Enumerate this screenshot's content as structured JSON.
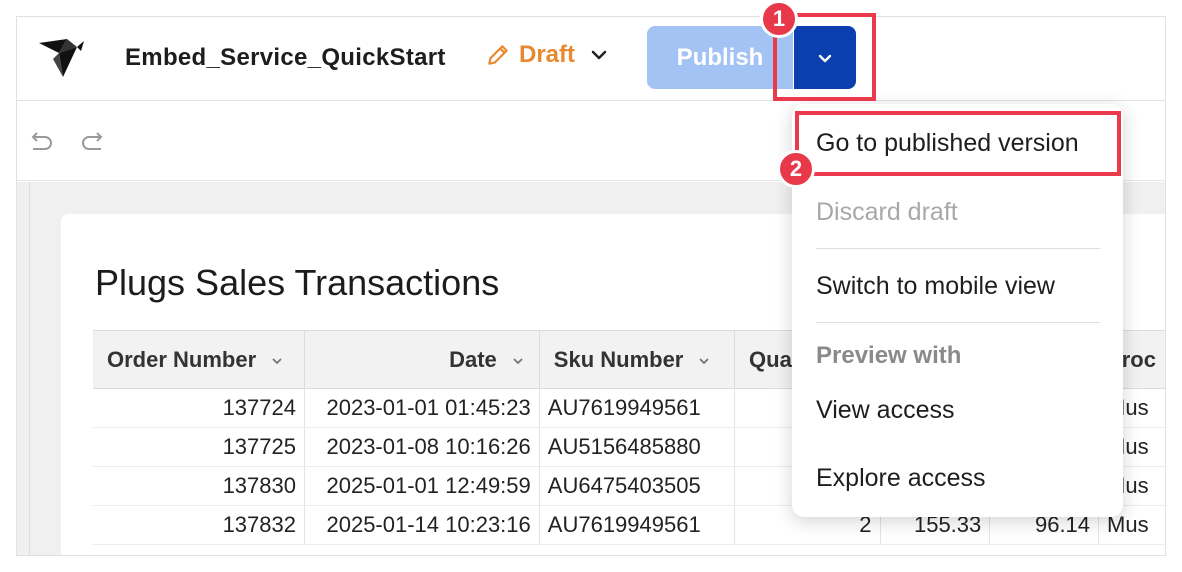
{
  "header": {
    "workbook_title": "Embed_Service_QuickStart",
    "status_label": "Draft",
    "publish_label": "Publish"
  },
  "toolbar": {
    "undo_icon": "undo-icon",
    "redo_icon": "redo-icon"
  },
  "card": {
    "title": "Plugs Sales Transactions"
  },
  "table": {
    "columns": [
      "Order Number",
      "Date",
      "Sku Number",
      "Qua",
      "",
      "",
      "Proc"
    ],
    "rows": [
      [
        "137724",
        "2023-01-01 01:45:23",
        "AU7619949561",
        "",
        "",
        "",
        "Mus"
      ],
      [
        "137725",
        "2023-01-08 10:16:26",
        "AU5156485880",
        "",
        "",
        "",
        "Mus"
      ],
      [
        "137830",
        "2025-01-01 12:49:59",
        "AU6475403505",
        "",
        "",
        "",
        "Mus"
      ],
      [
        "137832",
        "2025-01-14 10:23:16",
        "AU7619949561",
        "2",
        "155.33",
        "96.14",
        "Mus"
      ]
    ]
  },
  "menu": {
    "go_to_published": "Go to published version",
    "discard_draft": "Discard draft",
    "switch_mobile": "Switch to mobile view",
    "preview_with_header": "Preview with",
    "view_access": "View access",
    "explore_access": "Explore access"
  },
  "annotations": {
    "step1": "1",
    "step2": "2"
  },
  "colors": {
    "draft": "#e8882f",
    "publish_disabled": "#a3c3f4",
    "publish_dropdown": "#0b3fb0",
    "annotation": "#e8394a"
  }
}
